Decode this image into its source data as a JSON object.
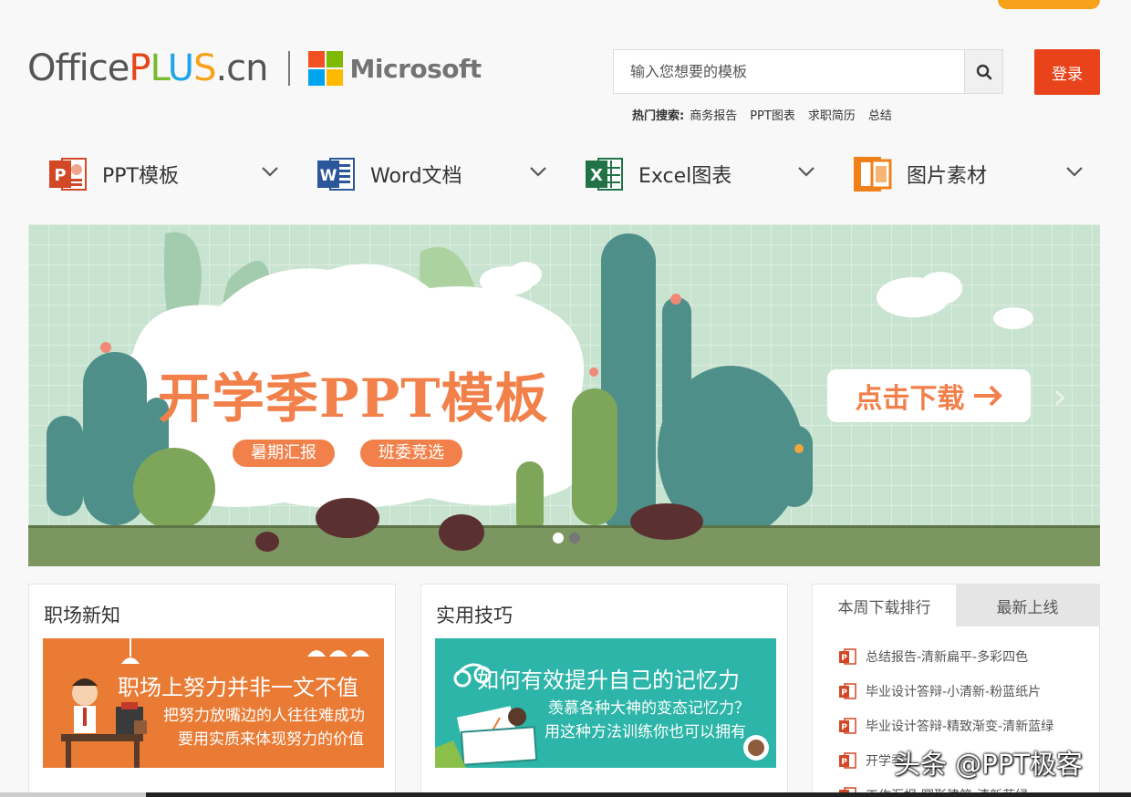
{
  "brand": {
    "office_prefix": "Office",
    "plus_p": "P",
    "plus_l": "L",
    "plus_u": "U",
    "plus_s": "S",
    "suffix": ".cn",
    "partner": "Microsoft"
  },
  "search": {
    "placeholder": "输入您想要的模板",
    "icon": "search-icon"
  },
  "login_label": "登录",
  "hot_search": {
    "label": "热门搜索:",
    "items": [
      "商务报告",
      "PPT图表",
      "求职简历",
      "总结"
    ]
  },
  "nav": [
    {
      "label": "PPT模板",
      "icon": "ppt-icon",
      "color": "#d24726"
    },
    {
      "label": "Word文档",
      "icon": "word-icon",
      "color": "#2b579a"
    },
    {
      "label": "Excel图表",
      "icon": "excel-icon",
      "color": "#217346"
    },
    {
      "label": "图片素材",
      "icon": "image-icon",
      "color": "#f0801a"
    }
  ],
  "banner": {
    "title": "开学季PPT模板",
    "tags": [
      "暑期汇报",
      "班委竞选"
    ],
    "cta": "点击下载",
    "slides": 2,
    "active_slide": 1
  },
  "cards": [
    {
      "title": "职场新知",
      "headline": "职场上努力并非一文不值",
      "sub1": "把努力放嘴边的人往往难成功",
      "sub2": "要用实质来体现努力的价值"
    },
    {
      "title": "实用技巧",
      "headline": "如何有效提升自己的记忆力",
      "sub1": "羡慕各种大神的变态记忆力？",
      "sub2": "用这种方法训练你也可以拥有"
    }
  ],
  "ranking": {
    "tabs": [
      "本周下载排行",
      "最新上线"
    ],
    "items": [
      "总结报告-清新扁平-多彩四色",
      "毕业设计答辩-小清新-粉蓝纸片",
      "毕业设计答辩-精致渐变-清新蓝绿",
      "开学季-",
      "工作汇报-圆形建筑-清新蓝绿"
    ]
  },
  "watermark": "头条 @PPT极客",
  "colors": {
    "accent_orange": "#f7a21b",
    "login_red": "#e8431a",
    "banner_orange": "#f2804a",
    "banner_bg": "#c8e3cf"
  }
}
